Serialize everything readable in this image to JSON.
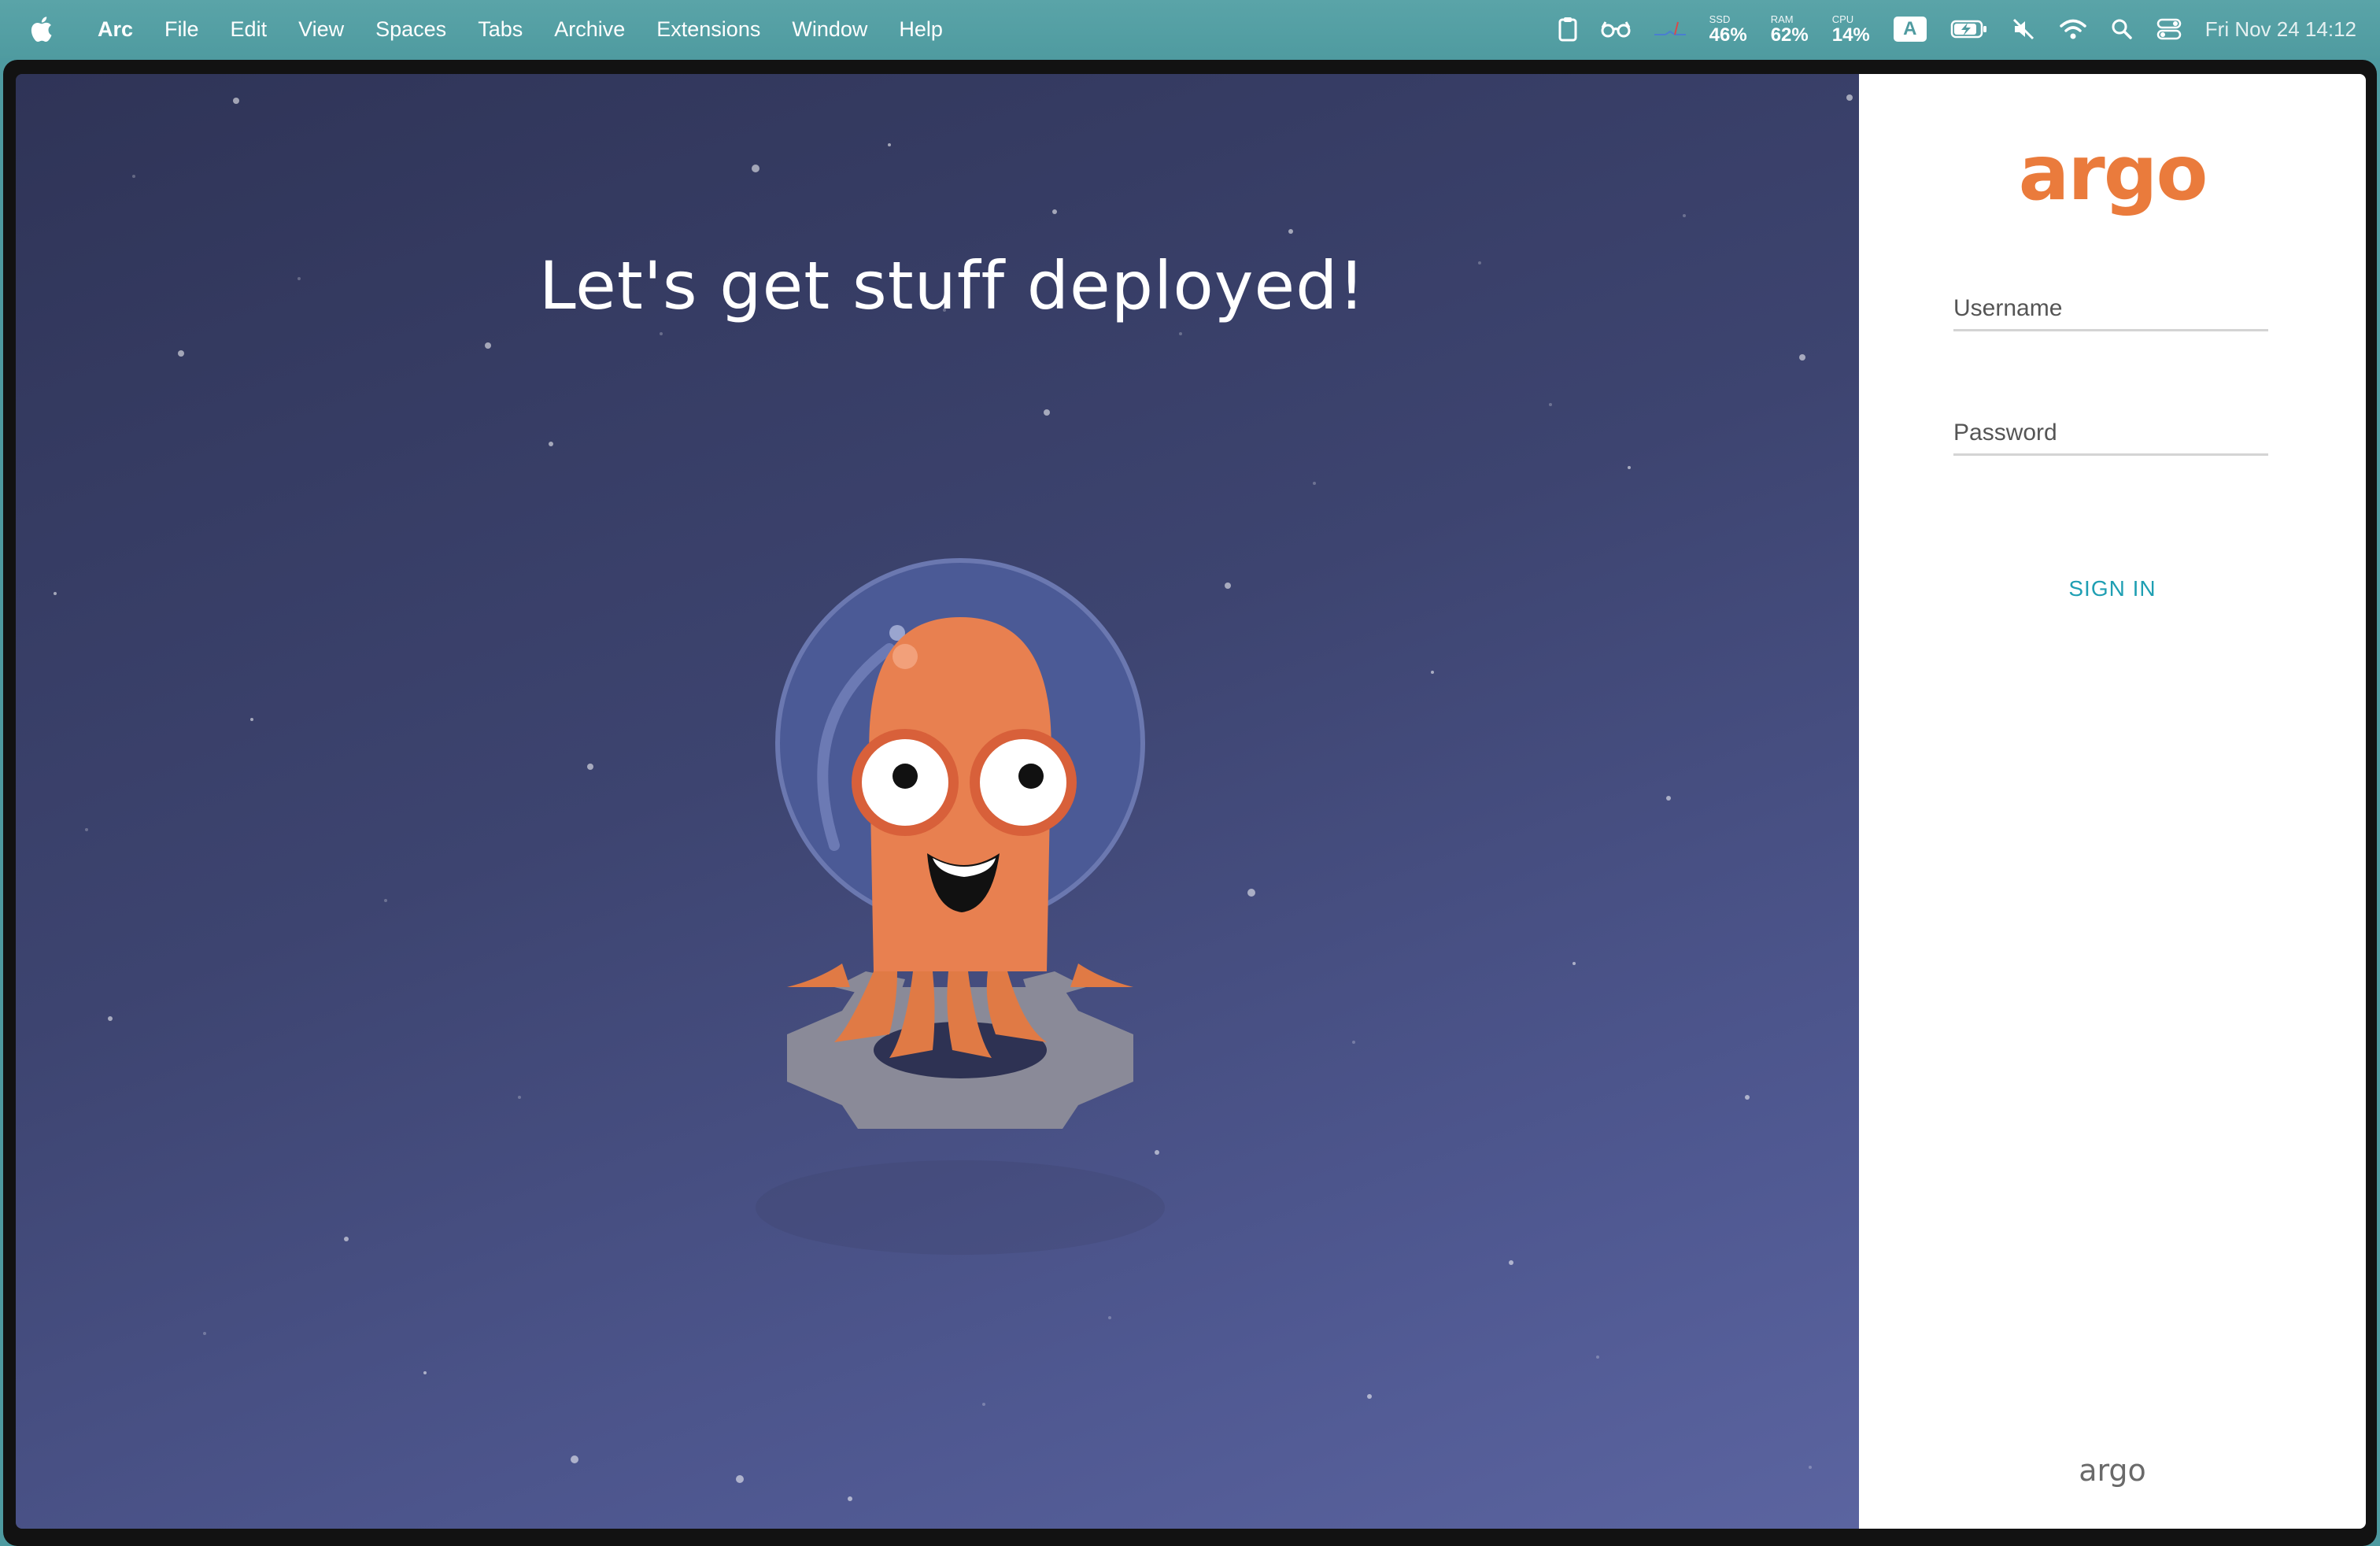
{
  "menubar": {
    "app_name": "Arc",
    "items": [
      "File",
      "Edit",
      "View",
      "Spaces",
      "Tabs",
      "Archive",
      "Extensions",
      "Window",
      "Help"
    ],
    "stats": [
      {
        "label": "SSD",
        "value": "46%"
      },
      {
        "label": "RAM",
        "value": "62%"
      },
      {
        "label": "CPU",
        "value": "14%"
      }
    ],
    "input_source": "A",
    "clock": "Fri Nov 24  14:12"
  },
  "hero": {
    "title": "Let's get stuff deployed!"
  },
  "login": {
    "logo": "argo",
    "username_placeholder": "Username",
    "password_placeholder": "Password",
    "signin_label": "SIGN IN",
    "footer_logo": "argo"
  },
  "colors": {
    "menubar": "#4f9ba0",
    "accent_orange": "#ea7b3c",
    "signin_teal": "#1f9fb3",
    "hero_bg": "#3d4470"
  }
}
